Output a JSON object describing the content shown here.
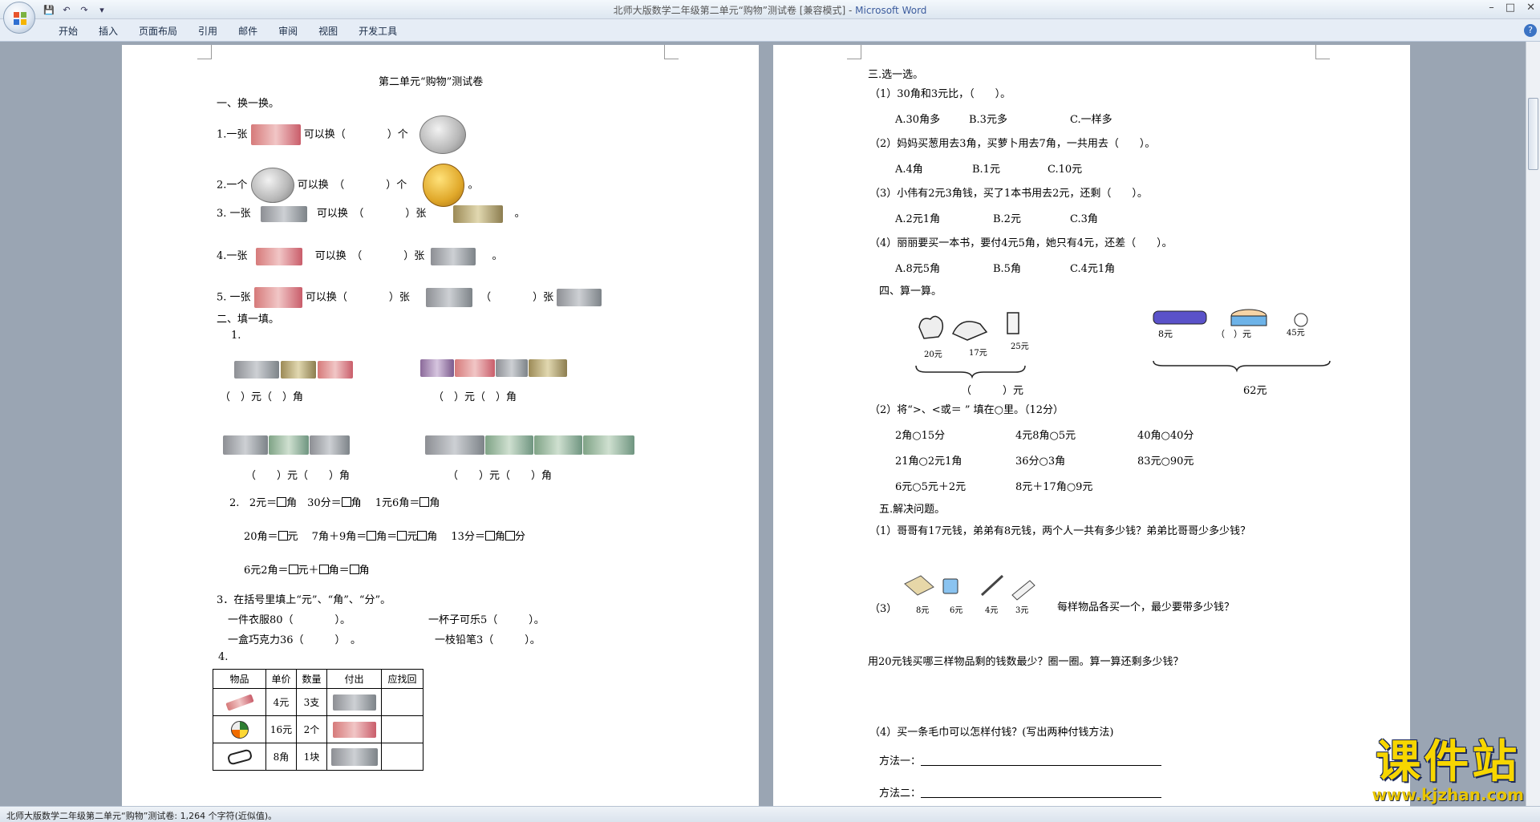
{
  "window": {
    "title_doc": "北师大版数学二年级第二单元“购物”测试卷 [兼容模式] - ",
    "title_app": "Microsoft Word"
  },
  "ribbon": {
    "tabs": [
      "开始",
      "插入",
      "页面布局",
      "引用",
      "邮件",
      "审阅",
      "视图",
      "开发工具"
    ]
  },
  "left_page": {
    "doc_title": "第二单元“购物”测试卷",
    "s1": "一、换一换。",
    "s1_l1a": "1.一张",
    "s1_l1b": "可以换（　　　　）个",
    "s1_l2a": "2.一个",
    "s1_l2b": "可以换　（　　　　）个",
    "s1_l2c": "。",
    "s1_l3a": "3. 一张",
    "s1_l3b": "可以换　（　　　　）张",
    "s1_l3c": "。",
    "s1_l4a": "4.一张",
    "s1_l4b": "可以换　（　　　　）张",
    "s1_l4c": "。",
    "s1_l5a": "5. 一张",
    "s1_l5b": "可以换（　　　　）张",
    "s1_l5c": "（　　　　）张",
    "s2": "二、填一填。",
    "s2_q1": "1.",
    "s2_a1": "（　）元（　）角",
    "s2_a2": "（　）元（　）角",
    "s2_a3": "（　　）元（　　）角",
    "s2_a4": "（　　）元（　　）角",
    "s2_q2_num": "2.",
    "s2_q2_a": "2元＝",
    "s2_q2_b": "角　30分＝",
    "s2_q2_c": "角　 1元6角＝",
    "s2_q2_d": "角",
    "s2_r2_a": "20角＝",
    "s2_r2_b": "元　 7角＋9角＝",
    "s2_r2_c": "角＝",
    "s2_r2_d": "元",
    "s2_r2_e": "角　 13分＝",
    "s2_r2_f": "角",
    "s2_r2_g": "分",
    "s2_r3_a": "6元2角＝",
    "s2_r3_b": "元＋",
    "s2_r3_c": "角＝",
    "s2_r3_d": "角",
    "s2_q3": "3．在括号里填上“元”、“角”、“分”。",
    "s2_q3_l1a": "一件衣服80（　　　　）。",
    "s2_q3_l1b": "一杯子可乐5（　　　）。",
    "s2_q3_l2a": "一盒巧克力36（　　　）　。",
    "s2_q3_l2b": "一枝铅笔3（　　　）。",
    "s2_q4": "4.",
    "table_headers": [
      "物品",
      "单价",
      "数量",
      "付出",
      "应找回"
    ],
    "table_rows": [
      {
        "price": "4元",
        "qty": "3支"
      },
      {
        "price": "16元",
        "qty": "2个"
      },
      {
        "price": "8角",
        "qty": "1块"
      }
    ]
  },
  "right_page": {
    "s3": "三.选一选。",
    "q1": "（1）30角和3元比，（　　）。",
    "q1_opts": [
      "A.30角多",
      "B.3元多",
      "C.一样多"
    ],
    "q2": "（2）妈妈买葱用去3角，买萝卜用去7角，一共用去（　　）。",
    "q2_opts": [
      "A.4角",
      "B.1元",
      "C.10元"
    ],
    "q3": "（3）小伟有2元3角钱，买了1本书用去2元，还剩（　　）。",
    "q3_opts": [
      "A.2元1角",
      "B.2元",
      "C.3角"
    ],
    "q4": "（4）丽丽要买一本书，要付4元5角，她只有4元，还差（　　）。",
    "q4_opts": [
      "A.8元5角",
      "B.5角",
      "C.4元1角"
    ],
    "s4": "四、算一算。",
    "price_left": [
      "20元",
      "17元",
      "25元"
    ],
    "price_right": [
      "8元",
      "（　）元",
      "45元"
    ],
    "ans_left": "（　　　）元",
    "ans_right": "62元",
    "s4_q2": "（2）将“>、<或＝ ” 填在○里。（12分）",
    "cmp": [
      [
        "2角○15分",
        "4元8角○5元",
        "40角○40分"
      ],
      [
        "21角○2元1角",
        "36分○3角",
        "83元○90元"
      ],
      [
        "6元○5元＋2元",
        "8元＋17角○9元",
        ""
      ]
    ],
    "s5": "五.解决问题。",
    "p1": "（1）哥哥有17元钱，弟弟有8元钱，两个人一共有多少钱？弟弟比哥哥少多少钱？",
    "p3_num": "（3）",
    "p3_prices": [
      "8元",
      "6元",
      "4元",
      "3元"
    ],
    "p3_text": "每样物品各买一个，最少要带多少钱？",
    "p3b": "用20元钱买哪三样物品剩的钱数最少？圈一圈。算一算还剩多少钱？",
    "p4": "（4）买一条毛巾可以怎样付钱？(写出两种付钱方法)",
    "m1": "方法一：",
    "m2": "方法二："
  },
  "status": {
    "text": "北师大版数学二年级第二单元“购物”测试卷: 1,264 个字符(近似值)。"
  },
  "watermark": {
    "main": "课件站",
    "url": "www.kjzhan.com"
  }
}
